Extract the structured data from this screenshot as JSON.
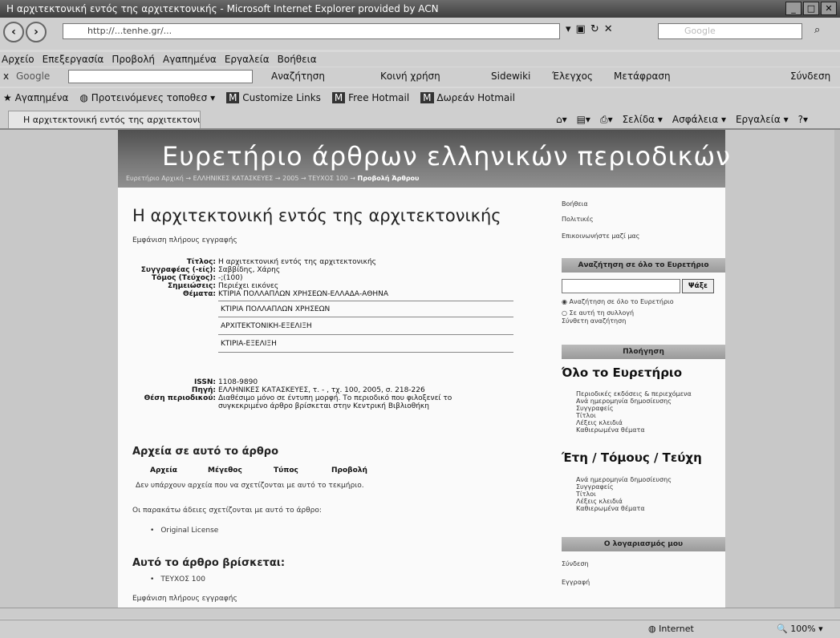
{
  "window": {
    "title": "Η αρχιτεκτονική εντός της αρχιτεκτονικής - Microsoft Internet Explorer provided by ACN"
  },
  "address": {
    "url": "http://...tenhe.gr/...",
    "search_placeholder": "Google"
  },
  "menu": [
    "Αρχείο",
    "Επεξεργασία",
    "Προβολή",
    "Αγαπημένα",
    "Εργαλεία",
    "Βοήθεια"
  ],
  "google_bar": {
    "label": "Google",
    "search": "Αναζήτηση",
    "share": "Κοινή χρήση",
    "sidewiki": "Sidewiki",
    "check": "Έλεγχος",
    "translate": "Μετάφραση",
    "signin": "Σύνδεση"
  },
  "favorites": {
    "label": "Αγαπημένα",
    "suggested": "Προτεινόμενες τοποθεσ",
    "links": [
      "Customize Links",
      "Free Hotmail",
      "Δωρεάν Hotmail"
    ]
  },
  "tab": {
    "label": "Η αρχιτεκτονική εντός της αρχιτεκτονι"
  },
  "commands": [
    "Σελίδα",
    "Ασφάλεια",
    "Εργαλεία"
  ],
  "banner": {
    "title": "Ευρετήριο άρθρων ελληνικών περιοδικών",
    "crumbs": "Ευρετήριο Αρχική → ΕΛΛΗΝΙΚΕΣ ΚΑΤΑΣΚΕΥΕΣ → 2005 → ΤΕΥΧΟΣ 100 →",
    "crumb_current": "Προβολή Άρθρου"
  },
  "article": {
    "title": "Η αρχιτεκτονική εντός της αρχιτεκτονικής",
    "full_record": "Εμφάνιση πλήρους εγγραφής",
    "fields": [
      {
        "k": "Τίτλος:",
        "v": "Η αρχιτεκτονική εντός της αρχιτεκτονικής"
      },
      {
        "k": "Συγγραφέας (-είς):",
        "v": "Σαββίδης, Χάρης"
      },
      {
        "k": "Τόμος (Τεύχος):",
        "v": "-;(100)"
      },
      {
        "k": "Σημειώσεις:",
        "v": "Περιέχει εικόνες"
      },
      {
        "k": "Θέματα:",
        "v": "ΚΤΙΡΙΑ ΠΟΛΛΑΠΛΩΝ ΧΡΗΣΕΩΝ-ΕΛΛΑΔΑ-ΑΘΗΝΑ"
      }
    ],
    "subjects": [
      "ΚΤΙΡΙΑ ΠΟΛΛΑΠΛΩΝ ΧΡΗΣΕΩΝ",
      "ΑΡΧΙΤΕΚΤΟΝΙΚΗ-ΕΞΕΛΙΞΗ",
      "ΚΤΙΡΙΑ-ΕΞΕΛΙΞΗ"
    ],
    "issn_k": "ISSN:",
    "issn_v": "1108-9890",
    "source_k": "Πηγή:",
    "source_v": "ΕΛΛΗΝΙΚΕΣ ΚΑΤΑΣΚΕΥΕΣ, τ. - , τχ. 100, 2005, σ. 218-226",
    "loc_k": "Θέση περιοδικού:",
    "loc_v1": "Διαθέσιμο μόνο σε έντυπη μορφή. Το περιοδικό που φιλοξενεί το",
    "loc_v2": "συγκεκριμένο άρθρο βρίσκεται στην Κεντρική Βιβλιοθήκη",
    "files_heading": "Αρχεία σε αυτό το άρθρο",
    "file_cols": [
      "Αρχεία",
      "Μέγεθος",
      "Τύπος",
      "Προβολή"
    ],
    "no_files": "Δεν υπάρχουν αρχεία που να σχετίζονται με αυτό το τεκμήριο.",
    "license_text": "Οι παρακάτω άδειες σχετίζονται με αυτό το άρθρο:",
    "license": "Original License",
    "located_heading": "Αυτό το άρθρο βρίσκεται:",
    "located": "ΤΕΥΧΟΣ 100",
    "full_record2": "Εμφάνιση πλήρους εγγραφής"
  },
  "sidebar": {
    "links": [
      "Βοήθεια",
      "Πολιτικές",
      "Επικοινωνήστε μαζί μας"
    ],
    "search_header": "Αναζήτηση σε όλο το Ευρετήριο",
    "go": "Ψάξε",
    "radio_all": "Αναζήτηση σε όλο το Ευρετήριο",
    "radio_coll": "Σε αυτή τη συλλογή",
    "advanced": "Σύνθετη αναζήτηση",
    "nav_header": "Πλοήγηση",
    "all_title": "Όλο το Ευρετήριο",
    "all_links": [
      "Περιοδικές εκδόσεις & περιεχόμενα",
      "Ανά ημερομηνία δημοσίευσης",
      "Συγγραφείς",
      "Τίτλοι",
      "Λέξεις κλειδιά",
      "Καθιερωμένα θέματα"
    ],
    "years_title": "Έτη / Τόμους / Τεύχη",
    "years_links": [
      "Ανά ημερομηνία δημοσίευσης",
      "Συγγραφείς",
      "Τίτλοι",
      "Λέξεις κλειδιά",
      "Καθιερωμένα θέματα"
    ],
    "account_header": "Ο λογαριασμός μου",
    "account_links": [
      "Σύνδεση",
      "Εγγραφή"
    ]
  },
  "status": {
    "zone": "Internet",
    "zoom": "100%"
  }
}
